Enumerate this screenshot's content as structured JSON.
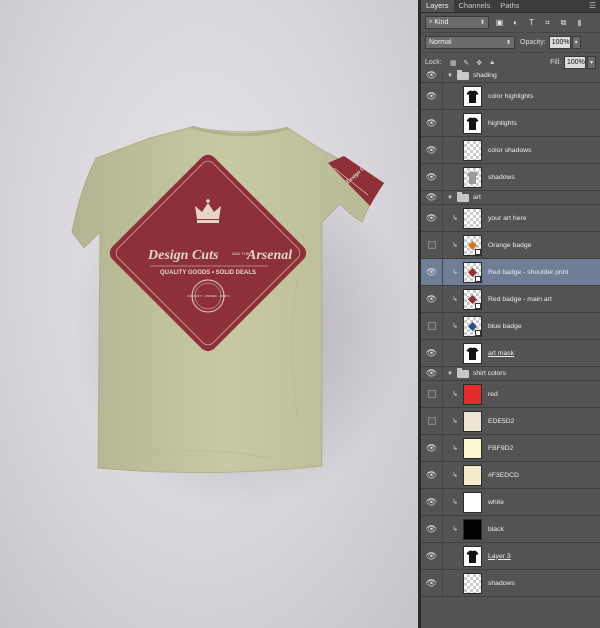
{
  "panel": {
    "tabs": [
      "Layers",
      "Channels",
      "Paths"
    ],
    "filter": {
      "value": "Kind"
    },
    "blend_mode": "Normal",
    "opacity": {
      "label": "Opacity:",
      "value": "100%"
    },
    "lock": {
      "label": "Lock:"
    },
    "fill": {
      "label": "Fill:",
      "value": "100%"
    }
  },
  "layers": [
    {
      "name": "shading",
      "type": "group",
      "visible": true
    },
    {
      "name": "color highlights",
      "visible": true,
      "thumb": "shirt"
    },
    {
      "name": "highlights",
      "visible": true,
      "thumb": "shirt"
    },
    {
      "name": "color shadows",
      "visible": true,
      "thumb": "checker"
    },
    {
      "name": "shadows",
      "visible": true,
      "thumb": "checker-shirt"
    },
    {
      "name": "art",
      "type": "group",
      "visible": true
    },
    {
      "name": "your art here",
      "visible": true,
      "clipped": true,
      "thumb": "checker"
    },
    {
      "name": "Orange badge",
      "visible": false,
      "clipped": true,
      "thumb": "smart"
    },
    {
      "name": "Red badge - shoulder print",
      "visible": true,
      "clipped": true,
      "thumb": "smart",
      "selected": true
    },
    {
      "name": "Red badge - main art",
      "visible": true,
      "clipped": true,
      "thumb": "smart"
    },
    {
      "name": "blue badge",
      "visible": false,
      "clipped": true,
      "thumb": "smart"
    },
    {
      "name": "art mask",
      "visible": true,
      "thumb": "shirt",
      "underline": true
    },
    {
      "name": "shirt colors",
      "type": "group",
      "visible": true
    },
    {
      "name": "red",
      "visible": false,
      "clipped": true,
      "thumb": "swatch",
      "color": "#e32b2b"
    },
    {
      "name": "EDE5D2",
      "visible": false,
      "clipped": true,
      "thumb": "swatch",
      "color": "#EDE5D2"
    },
    {
      "name": "FBF9D2",
      "visible": true,
      "clipped": true,
      "thumb": "swatch",
      "color": "#FBF9D2"
    },
    {
      "name": "#F3EDCD",
      "visible": true,
      "clipped": true,
      "thumb": "swatch",
      "color": "#F3EDCD"
    },
    {
      "name": "white",
      "visible": true,
      "clipped": true,
      "thumb": "swatch",
      "color": "#ffffff"
    },
    {
      "name": "black",
      "visible": true,
      "clipped": true,
      "thumb": "swatch",
      "color": "#000000"
    },
    {
      "name": "Layer 3",
      "visible": true,
      "thumb": "shirt",
      "underline": true
    },
    {
      "name": "shadows",
      "visible": true,
      "thumb": "checker"
    }
  ],
  "artwork": {
    "badge_line1": "Design Cuts",
    "badge_line2": "Arsenal",
    "badge_and": "AND THE",
    "badge_tagline": "QUALITY GOODS • SOLID DEALS",
    "seal_text": "COMMUNITY · INSPIRED · ASSETS",
    "shirt_color": "#c7c9a3",
    "badge_color": "#8d3037",
    "ink_color": "#e3d7c4"
  }
}
